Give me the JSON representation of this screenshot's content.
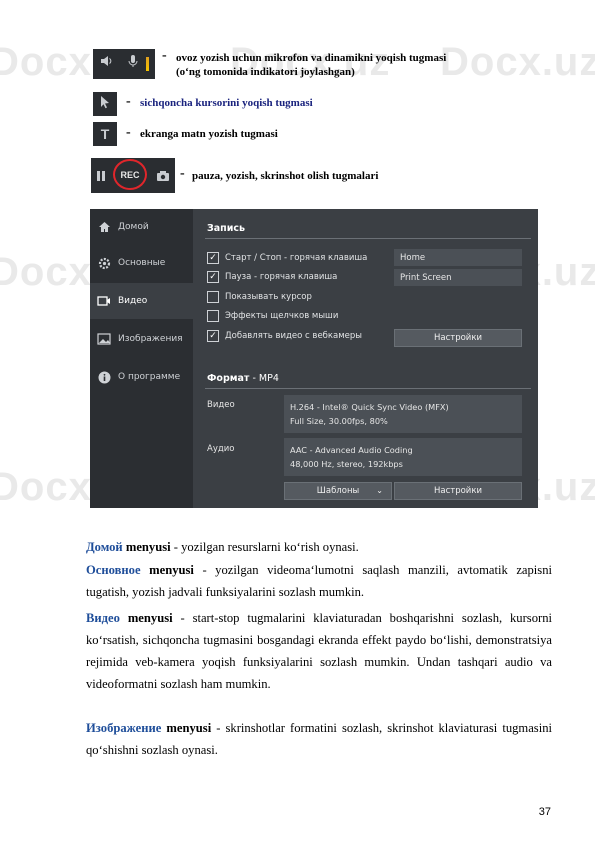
{
  "legend": [
    {
      "id": "mic",
      "dash": "-",
      "line1": "ovoz yozish uchun mikrofon va dinamikni yoqish tugmasi",
      "line2": "(o‘ng tomonida indikatori joylashgan)"
    },
    {
      "id": "cursor",
      "dash": "-",
      "text": "sichqoncha kursorini yoqish tugmasi"
    },
    {
      "id": "text",
      "dash": "-",
      "text": "ekranga matn yozish tugmasi"
    },
    {
      "id": "rec",
      "dash": "-",
      "text": "pauza, yozish, skrinshot olish tugmalari",
      "rec_label": "REC"
    }
  ],
  "app": {
    "sidebar": [
      {
        "label": "Домой",
        "icon": "home-icon"
      },
      {
        "label": "Основные",
        "icon": "gear-icon"
      },
      {
        "label": "Видео",
        "icon": "video-icon"
      },
      {
        "label": "Изображения",
        "icon": "image-icon"
      },
      {
        "label": "О программе",
        "icon": "info-icon"
      }
    ],
    "record_section_title": "Запись",
    "checkboxes": [
      {
        "label": "Старт / Стоп - горячая клавиша",
        "checked": true
      },
      {
        "label": "Пауза - горячая клавиша",
        "checked": true
      },
      {
        "label": "Показывать курсор",
        "checked": false
      },
      {
        "label": "Эффекты щелчков мыши",
        "checked": false
      },
      {
        "label": "Добавлять видео с вебкамеры",
        "checked": true
      }
    ],
    "hotkey_start": "Home",
    "hotkey_pause": "Print Screen",
    "settings_button": "Настройки",
    "format_title": "Формат",
    "format_value": "MP4",
    "video_label": "Видео",
    "video_codec_line1": "H.264 - Intel® Quick Sync Video (MFX)",
    "video_codec_line2": "Full Size, 30.00fps, 80%",
    "audio_label": "Аудио",
    "audio_codec_line1": "AAC - Advanced Audio Coding",
    "audio_codec_line2": "48,000 Hz, stereo, 192kbps",
    "templates_select": "Шаблоны",
    "settings_button2": "Настройки"
  },
  "paragraphs": [
    {
      "term": "Домой",
      "menu": "menyusi",
      "text": " - yozilgan resurslarni ko‘rish oynasi."
    },
    {
      "term": "Основное",
      "menu": "menyusi",
      "text": " - yozilgan videoma‘lumotni saqlash manzili, avtomatik zapisni tugatish, yozish jadvali funksiyalarini sozlash mumkin."
    },
    {
      "term": "Видео",
      "menu": "menyusi",
      "text": " - start-stop tugmalarini klaviaturadan boshqarishni sozlash, kursorni ko‘rsatish, sichqoncha tugmasini bosgandagi ekranda effekt paydo bo‘lishi, demonstratsiya rejimida veb-kamera yoqish funksiyalarini sozlash mumkin. Undan tashqari audio va videoformatni sozlash ham mumkin."
    },
    {
      "term": "Изображение",
      "menu": "menyusi",
      "text": " - skrinshotlar formatini sozlash, skrinshot klaviaturasi tugmasini qo‘shishni sozlash oynasi."
    }
  ],
  "page_number": "37",
  "watermark": "Docx.uz"
}
